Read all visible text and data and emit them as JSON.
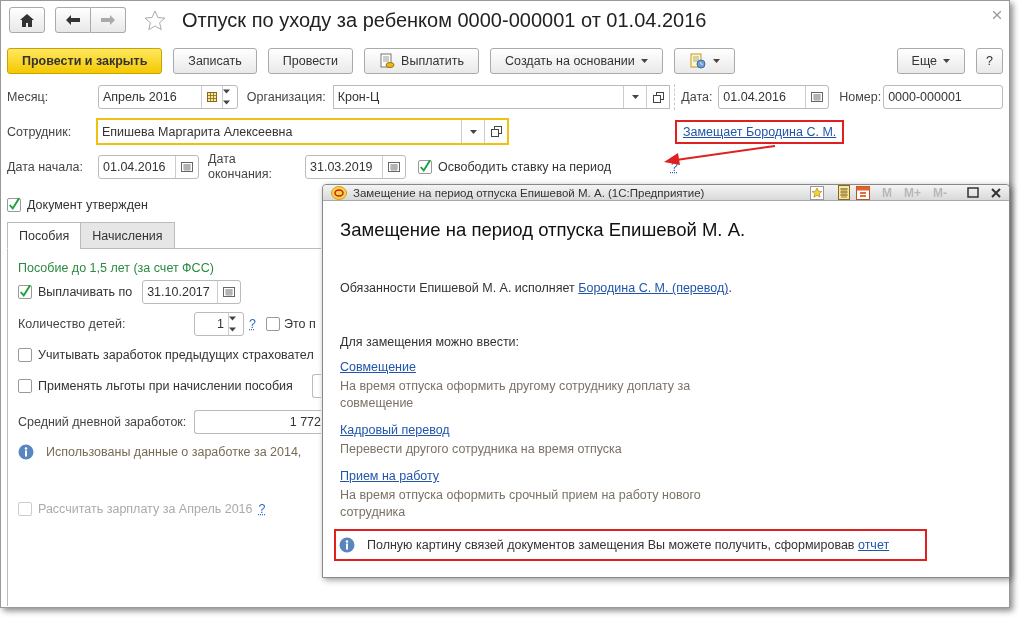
{
  "window": {
    "title": "Отпуск по уходу за ребенком 0000-000001 от 01.04.2016"
  },
  "toolbar": {
    "buttons": [
      {
        "label": "Провести и закрыть",
        "kind": "primary"
      },
      {
        "label": "Записать",
        "kind": "plain"
      },
      {
        "label": "Провести",
        "kind": "plain"
      },
      {
        "label": "Выплатить",
        "kind": "icon"
      },
      {
        "label": "Создать на основании",
        "kind": "menu"
      },
      {
        "kind": "icon-menu"
      }
    ],
    "right_buttons": [
      {
        "label": "Еще",
        "kind": "menu"
      },
      {
        "label": "?",
        "kind": "plain"
      }
    ]
  },
  "month": {
    "label": "Месяц:",
    "value": "Апрель 2016"
  },
  "organization": {
    "label": "Организация:",
    "value": "Крон-Ц"
  },
  "date": {
    "label": "Дата:",
    "value": "01.04.2016"
  },
  "number": {
    "label": "Номер:",
    "value": "0000-000001"
  },
  "employee": {
    "label": "Сотрудник:",
    "value": "Епишева Маргарита Алексеевна",
    "focused": true
  },
  "replaces_link": {
    "text": "Замещает Бородина С. М.",
    "highlighted": true
  },
  "start_date": {
    "label": "Дата начала:",
    "value": "01.04.2016"
  },
  "end_date": {
    "label": "Дата окончания:",
    "value": "31.03.2019"
  },
  "release_rate": {
    "label": "Освободить ставку на период",
    "checked": true,
    "help": "?"
  },
  "document_approved": {
    "label": "Документ утвержден",
    "checked": true
  },
  "tabs": [
    {
      "label": "Пособия",
      "selected": true
    },
    {
      "label": "Начисления",
      "selected": false
    }
  ],
  "benefit": {
    "section_title": "Пособие до 1,5 лет (за счет ФСС)",
    "pay_until": {
      "label": "Выплачивать по",
      "checked": true,
      "value": "31.10.2017"
    },
    "children": {
      "label": "Количество детей:",
      "value": "1",
      "help": "?",
      "option": {
        "label": "Это п",
        "checked": false
      }
    },
    "checkboxes": [
      {
        "label": "Учитывать заработок предыдущих страховател",
        "checked": false
      },
      {
        "label": "Применять льготы при начислении пособия",
        "checked": false
      }
    ],
    "avg_earnings": {
      "label": "Средний дневной заработок:",
      "value": "1 772"
    },
    "info": "Использованы данные о заработке за  2014,",
    "recalc": {
      "label": "Рассчитать зарплату за Апрель 2016",
      "checked": false,
      "disabled": true,
      "help": "?"
    }
  },
  "dialog": {
    "title": "Замещение на период отпуска Епишевой М. А.  (1С:Предприятие)",
    "memory_buttons": [
      "M",
      "M+",
      "M-"
    ],
    "heading": "Замещение на период отпуска Епишевой М. А.",
    "duties": {
      "text": "Обязанности Епишевой М. А. исполняет ",
      "link": "Бородина С. М. (перевод)",
      "tail": "."
    },
    "intro": "Для замещения можно ввести:",
    "options": [
      {
        "link": "Совмещение",
        "description": "На время отпуска оформить другому сотруднику доплату за совмещение"
      },
      {
        "link": "Кадровый перевод",
        "description": "Перевести другого сотрудника на время отпуска"
      },
      {
        "link": "Прием на работу",
        "description": "На время отпуска оформить срочный прием на работу нового сотрудника"
      }
    ],
    "info": {
      "text": "Полную картину связей документов замещения Вы можете получить, сформировав ",
      "link": "отчет",
      "highlighted": true
    }
  }
}
